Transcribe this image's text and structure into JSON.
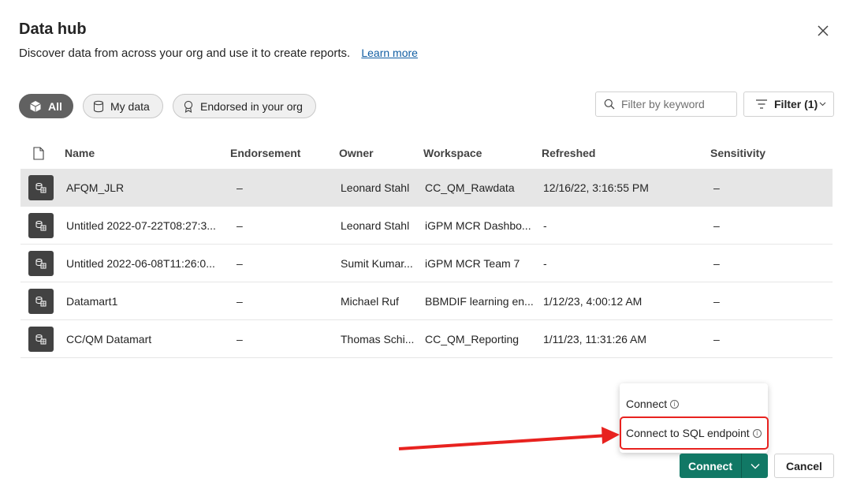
{
  "dialog": {
    "title": "Data hub",
    "subtitle": "Discover data from across your org and use it to create reports.",
    "learn_more": "Learn more"
  },
  "pills": [
    {
      "label": "All",
      "icon": "cube-icon",
      "active": true
    },
    {
      "label": "My data",
      "icon": "database-icon",
      "active": false
    },
    {
      "label": "Endorsed in your org",
      "icon": "ribbon-icon",
      "active": false
    }
  ],
  "search": {
    "placeholder": "Filter by keyword"
  },
  "filter": {
    "label": "Filter (1)"
  },
  "table": {
    "headers": [
      "Name",
      "Endorsement",
      "Owner",
      "Workspace",
      "Refreshed",
      "Sensitivity"
    ],
    "rows": [
      {
        "name": "AFQM_JLR",
        "endorsement": "–",
        "owner": "Leonard Stahl",
        "workspace": "CC_QM_Rawdata",
        "refreshed": "12/16/22, 3:16:55 PM",
        "sensitivity": "–",
        "selected": true
      },
      {
        "name": "Untitled 2022-07-22T08:27:3...",
        "endorsement": "–",
        "owner": "Leonard Stahl",
        "workspace": "iGPM MCR Dashbo...",
        "refreshed": "-",
        "sensitivity": "–",
        "selected": false
      },
      {
        "name": "Untitled 2022-06-08T11:26:0...",
        "endorsement": "–",
        "owner": "Sumit Kumar...",
        "workspace": "iGPM MCR Team 7",
        "refreshed": "-",
        "sensitivity": "–",
        "selected": false
      },
      {
        "name": "Datamart1",
        "endorsement": "–",
        "owner": "Michael Ruf",
        "workspace": "BBMDIF learning en...",
        "refreshed": "1/12/23, 4:00:12 AM",
        "sensitivity": "–",
        "selected": false
      },
      {
        "name": "CC/QM Datamart",
        "endorsement": "–",
        "owner": "Thomas Schi...",
        "workspace": "CC_QM_Reporting",
        "refreshed": "1/11/23, 11:31:26 AM",
        "sensitivity": "–",
        "selected": false
      }
    ]
  },
  "menu": {
    "items": [
      {
        "label": "Connect",
        "icon": "info-icon"
      },
      {
        "label": "Connect to SQL endpoint",
        "icon": "info-icon"
      }
    ]
  },
  "footer": {
    "connect_label": "Connect",
    "cancel_label": "Cancel"
  },
  "colors": {
    "accent": "#117865",
    "annotation": "#e8221f",
    "selected_row": "#e6e6e6",
    "active_pill": "#616161"
  }
}
